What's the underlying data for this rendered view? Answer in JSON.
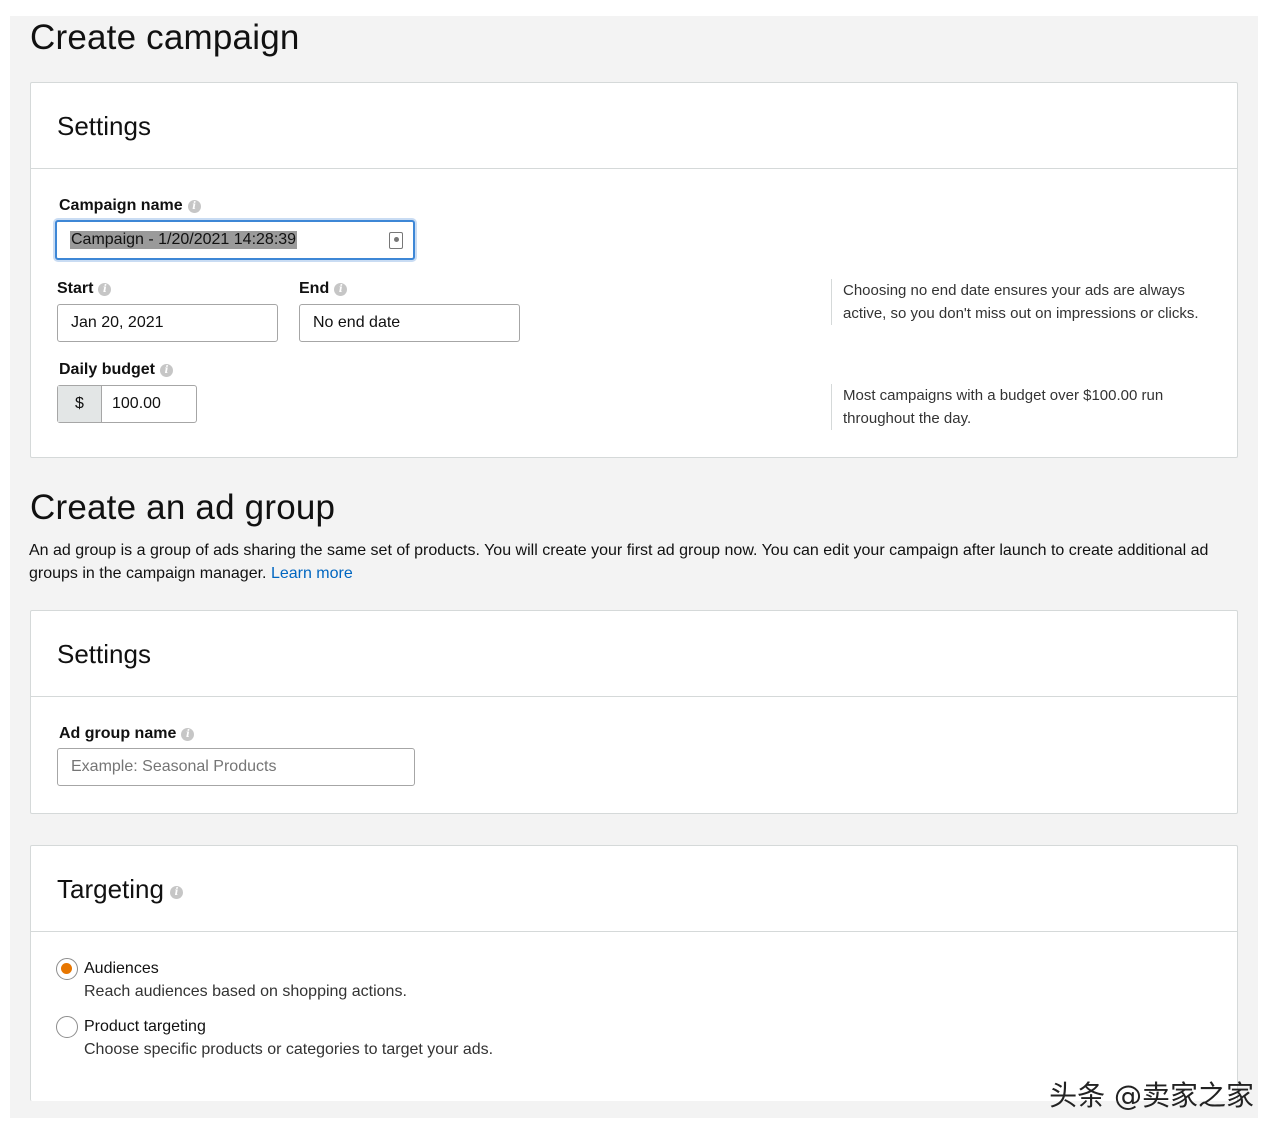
{
  "campaign": {
    "title": "Create campaign",
    "settings_title": "Settings",
    "campaign_name_label": "Campaign name",
    "campaign_name_value": "Campaign - 1/20/2021 14:28:39",
    "start_label": "Start",
    "start_value": "Jan 20, 2021",
    "end_label": "End",
    "end_value": "No end date",
    "end_hint": "Choosing no end date ensures your ads are always active, so you don't miss out on impressions or clicks.",
    "budget_label": "Daily budget",
    "budget_currency": "$",
    "budget_value": "100.00",
    "budget_hint": "Most campaigns with a budget over $100.00 run throughout the day."
  },
  "ad_group": {
    "title": "Create an ad group",
    "description": "An ad group is a group of ads sharing the same set of products. You will create your first ad group now. You can edit your campaign after launch to create additional ad groups in the campaign manager.",
    "learn_more": "Learn more",
    "settings_title": "Settings",
    "name_label": "Ad group name",
    "name_placeholder": "Example: Seasonal Products"
  },
  "targeting": {
    "title": "Targeting",
    "options": [
      {
        "label": "Audiences",
        "description": "Reach audiences based on shopping actions.",
        "selected": true
      },
      {
        "label": "Product targeting",
        "description": "Choose specific products or categories to target your ads.",
        "selected": false
      }
    ]
  },
  "watermark": "头条 @卖家之家",
  "colors": {
    "accent_radio": "#e77600",
    "link": "#0066c0",
    "focus": "#3e87d6"
  }
}
